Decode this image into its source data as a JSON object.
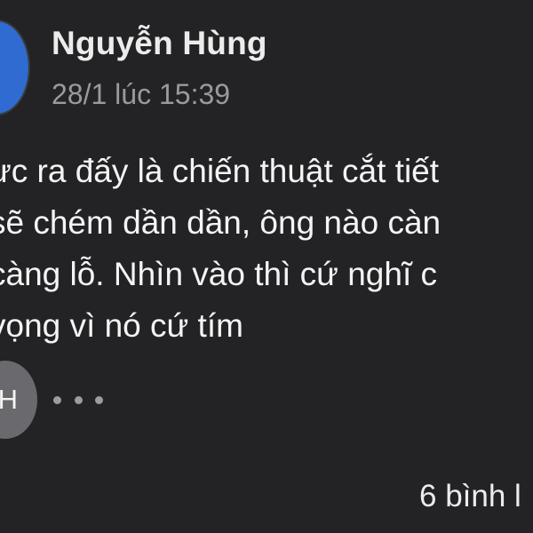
{
  "post": {
    "author": "Nguyễn Hùng",
    "timestamp": "28/1 lúc 15:39",
    "body_lines": [
      "ực ra đấy là chiến thuật cắt tiết",
      "sẽ chém dần dần, ông nào càn",
      "càng lỗ. Nhìn vào thì cứ nghĩ c",
      "vọng vì nó cứ tím"
    ]
  },
  "reactions": {
    "avatar_initial": "H",
    "more_icon": "more-dots-icon"
  },
  "footer": {
    "comments_label": "6 bình l"
  },
  "colors": {
    "background": "#232325",
    "avatar_blue": "#2f6bd0",
    "avatar_gray": "#6a6a6e",
    "muted_text": "#9a9a9e"
  }
}
